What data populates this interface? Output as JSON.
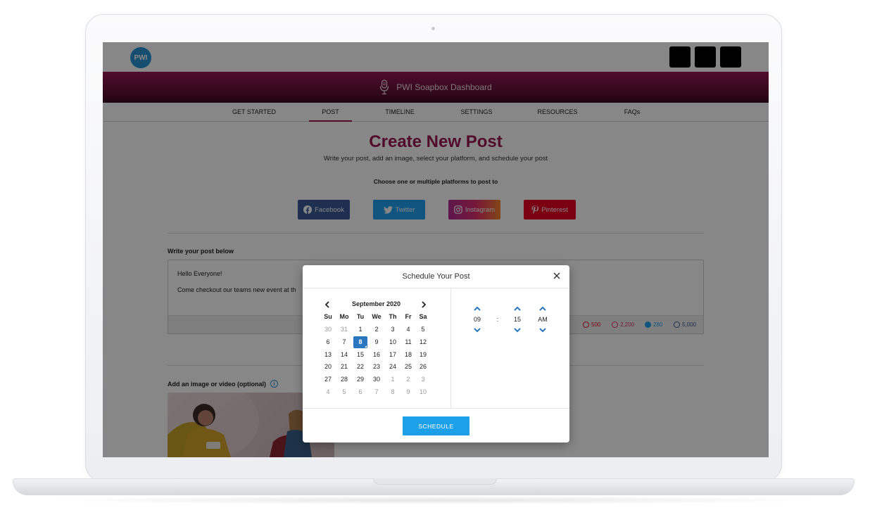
{
  "app": {
    "logo_text": "PWI",
    "dashboard_title": "PWI Soapbox Dashboard"
  },
  "nav": {
    "items": [
      {
        "label": "GET STARTED",
        "active": false
      },
      {
        "label": "POST",
        "active": true
      },
      {
        "label": "TIMELINE",
        "active": false
      },
      {
        "label": "SETTINGS",
        "active": false
      },
      {
        "label": "RESOURCES",
        "active": false
      },
      {
        "label": "FAQs",
        "active": false
      }
    ]
  },
  "page": {
    "title": "Create New Post",
    "subtitle": "Write your post, add an image, select your platform, and schedule your post",
    "choose_label": "Choose one or multiple platforms to post to"
  },
  "platforms": [
    {
      "label": "Facebook",
      "icon": "facebook-icon",
      "color": "#3b5998"
    },
    {
      "label": "Twitter",
      "icon": "twitter-icon",
      "color": "#1da1f2"
    },
    {
      "label": "Instagram",
      "icon": "instagram-icon",
      "color": "#c13584"
    },
    {
      "label": "Pinterest",
      "icon": "pinterest-icon",
      "color": "#e60023"
    }
  ],
  "post": {
    "label": "Write your post below",
    "line1": "Hello Everyone!",
    "line2": "Come checkout our teams new event at th",
    "counters": [
      {
        "icon": "pinterest-icon",
        "value": "500",
        "color": "#e60023"
      },
      {
        "icon": "instagram-icon",
        "value": "2,200",
        "color": "#e1306c"
      },
      {
        "icon": "twitter-icon",
        "value": "280",
        "color": "#1da1f2"
      },
      {
        "icon": "facebook-icon",
        "value": "5,000",
        "color": "#3b5998"
      }
    ]
  },
  "media": {
    "label": "Add an image or video (optional)"
  },
  "modal": {
    "title": "Schedule Your Post",
    "month": "September 2020",
    "days_of_week": [
      "Su",
      "Mo",
      "Tu",
      "We",
      "Th",
      "Fr",
      "Sa"
    ],
    "weeks": [
      [
        "30",
        "31",
        "1",
        "2",
        "3",
        "4",
        "5"
      ],
      [
        "6",
        "7",
        "8",
        "9",
        "10",
        "11",
        "12"
      ],
      [
        "13",
        "14",
        "15",
        "16",
        "17",
        "18",
        "19"
      ],
      [
        "20",
        "21",
        "22",
        "23",
        "24",
        "25",
        "26"
      ],
      [
        "27",
        "28",
        "29",
        "30",
        "1",
        "2",
        "3"
      ],
      [
        "4",
        "5",
        "6",
        "7",
        "8",
        "9",
        "10"
      ]
    ],
    "selected_day": "8",
    "hour": "09",
    "separator": ":",
    "minute": "15",
    "period": "AM",
    "schedule_label": "SCHEDULE"
  },
  "colors": {
    "brand": "#9a1854",
    "accent_blue": "#1ca1e8",
    "selected_day": "#2a76bf"
  }
}
